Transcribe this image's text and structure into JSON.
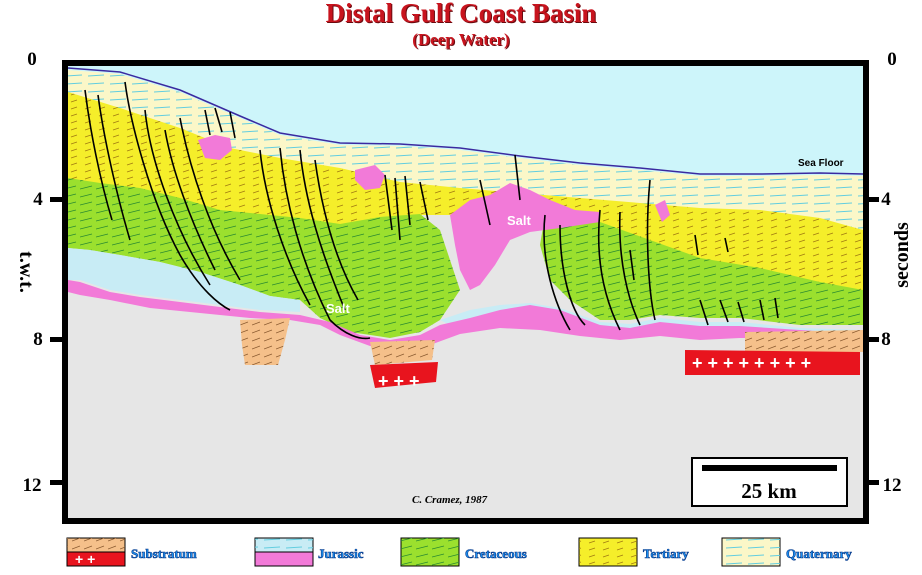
{
  "title": "Distal Gulf Coast Basin",
  "subtitle": "(Deep Water)",
  "y_axis_left_label": "t.w.t.",
  "y_axis_right_label": "seconds",
  "y_ticks": [
    "0",
    "4",
    "8",
    "12"
  ],
  "labels": {
    "sea_floor": "Sea Floor",
    "salt_1": "Salt",
    "salt_2": "Salt",
    "credit": "C. Cramez, 1987",
    "scale_bar": "25 km"
  },
  "legend": [
    {
      "name": "Substratum",
      "color": "#f5c08a"
    },
    {
      "name": "Jurassic",
      "color": "#c8ecf5"
    },
    {
      "name": "Cretaceous",
      "color": "#9be02e"
    },
    {
      "name": "Tertiary",
      "color": "#f5ee2a"
    },
    {
      "name": "Quaternary",
      "color": "#fbf7c8"
    }
  ],
  "colors": {
    "title": "#c8141e",
    "sea": "#cdf5fa",
    "salt": "#f27ad8",
    "basement": "#e6e6e6",
    "substratum_red": "#e8141e",
    "faults": "#000000",
    "legend_text": "#1a8ff0"
  }
}
